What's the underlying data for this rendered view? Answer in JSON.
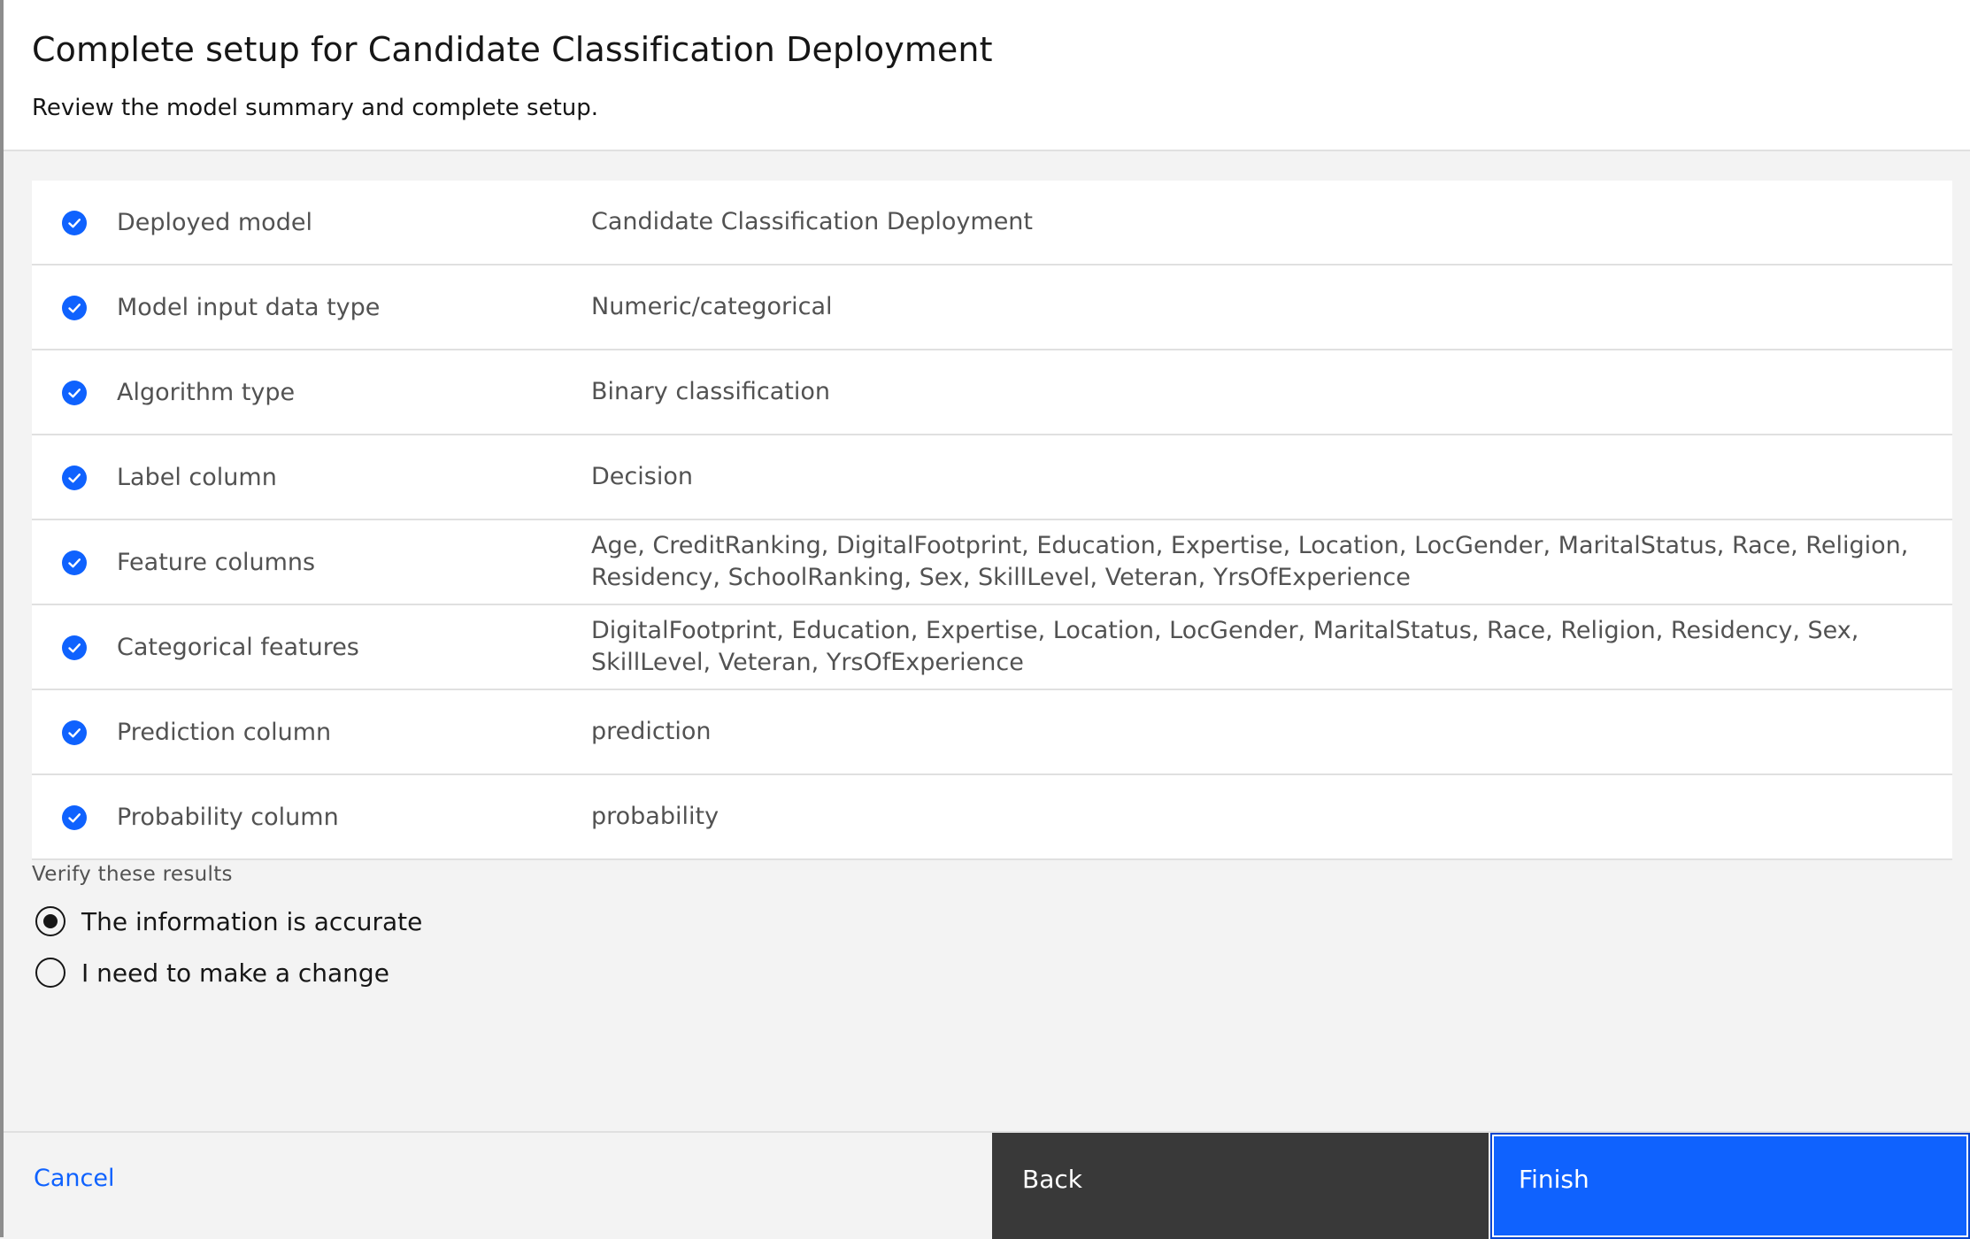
{
  "header": {
    "title": "Complete setup for Candidate Classification Deployment",
    "subtitle": "Review the model summary and complete setup."
  },
  "summary": {
    "rows": [
      {
        "label": "Deployed model",
        "value": "Candidate Classification Deployment",
        "icon": "checkmark-filled-icon"
      },
      {
        "label": "Model input data type",
        "value": "Numeric/categorical",
        "icon": "checkmark-filled-icon"
      },
      {
        "label": "Algorithm type",
        "value": "Binary classification",
        "icon": "checkmark-filled-icon"
      },
      {
        "label": "Label column",
        "value": "Decision",
        "icon": "checkmark-filled-icon"
      },
      {
        "label": "Feature columns",
        "value": "Age, CreditRanking, DigitalFootprint, Education, Expertise, Location, LocGender, MaritalStatus, Race, Religion, Residency, SchoolRanking, Sex, SkillLevel, Veteran, YrsOfExperience",
        "icon": "checkmark-filled-icon"
      },
      {
        "label": "Categorical features",
        "value": "DigitalFootprint, Education, Expertise, Location, LocGender, MaritalStatus, Race, Religion, Residency, Sex, SkillLevel, Veteran, YrsOfExperience",
        "icon": "checkmark-filled-icon"
      },
      {
        "label": "Prediction column",
        "value": "prediction",
        "icon": "checkmark-filled-icon"
      },
      {
        "label": "Probability column",
        "value": "probability",
        "icon": "checkmark-filled-icon"
      }
    ]
  },
  "verify": {
    "label": "Verify these results",
    "options": [
      {
        "label": "The information is accurate",
        "selected": true
      },
      {
        "label": "I need to make a change",
        "selected": false
      }
    ]
  },
  "footer": {
    "cancel_label": "Cancel",
    "back_label": "Back",
    "finish_label": "Finish"
  },
  "colors": {
    "accent": "#0f62fe",
    "back_button": "#393939",
    "background": "#f3f3f3"
  }
}
